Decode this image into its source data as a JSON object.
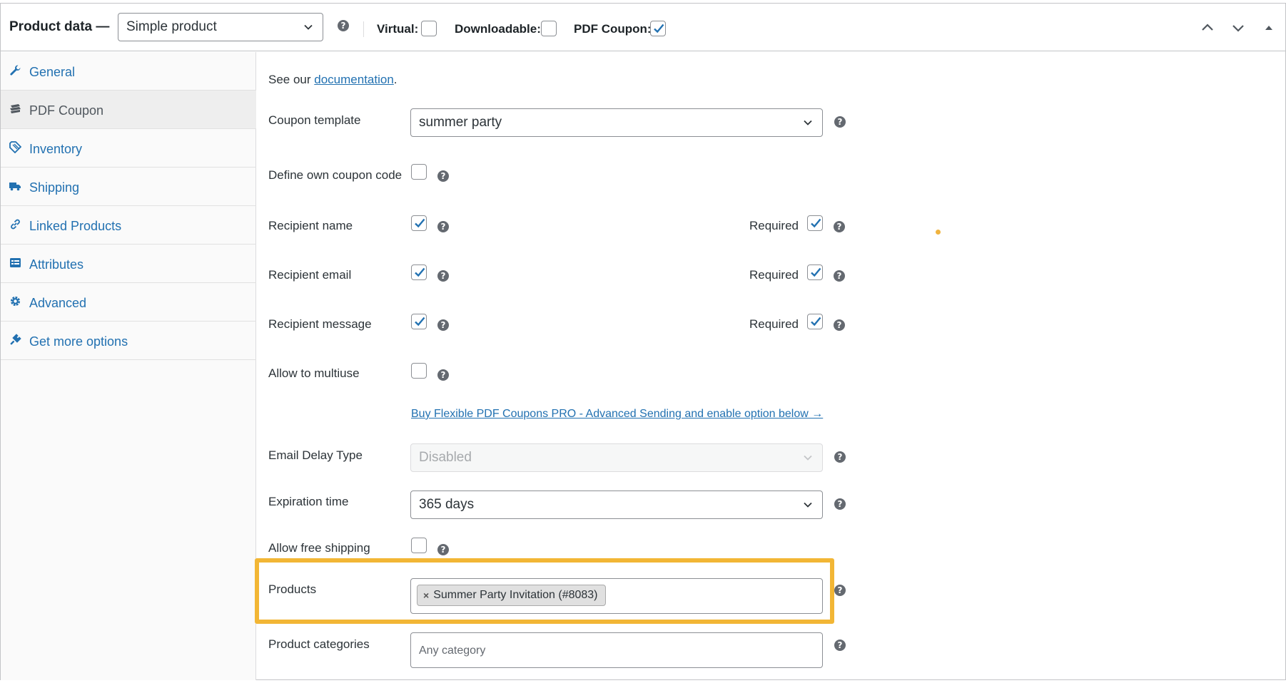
{
  "header": {
    "title": "Product data —",
    "product_type": "Simple product",
    "virtual_label": "Virtual:",
    "virtual_checked": false,
    "downloadable_label": "Downloadable:",
    "downloadable_checked": false,
    "pdf_coupon_label": "PDF Coupon:",
    "pdf_coupon_checked": true
  },
  "sidebar": {
    "items": [
      {
        "label": "General",
        "icon": "wrench-icon",
        "active": false
      },
      {
        "label": "PDF Coupon",
        "icon": "coupon-stack-icon",
        "active": true
      },
      {
        "label": "Inventory",
        "icon": "tag-icon",
        "active": false
      },
      {
        "label": "Shipping",
        "icon": "truck-icon",
        "active": false
      },
      {
        "label": "Linked Products",
        "icon": "link-icon",
        "active": false
      },
      {
        "label": "Attributes",
        "icon": "list-card-icon",
        "active": false
      },
      {
        "label": "Advanced",
        "icon": "gear-icon",
        "active": false
      },
      {
        "label": "Get more options",
        "icon": "plug-icon",
        "active": false
      }
    ]
  },
  "main": {
    "doc_prefix": "See our ",
    "doc_link": "documentation",
    "doc_suffix": ".",
    "coupon_template_label": "Coupon template",
    "coupon_template_value": "summer party",
    "define_code_label": "Define own coupon code",
    "recipient_name_label": "Recipient name",
    "recipient_email_label": "Recipient email",
    "recipient_message_label": "Recipient message",
    "required_label": "Required",
    "allow_multiuse_label": "Allow to multiuse",
    "pro_link": "Buy Flexible PDF Coupons PRO - Advanced Sending and enable option below →",
    "email_delay_label": "Email Delay Type",
    "email_delay_value": "Disabled",
    "expiration_label": "Expiration time",
    "expiration_value": "365 days",
    "free_shipping_label": "Allow free shipping",
    "products_label": "Products",
    "products_token": "Summer Party Invitation (#8083)",
    "categories_label": "Product categories",
    "categories_placeholder": "Any category"
  },
  "colors": {
    "link": "#2271b1",
    "highlight": "#f2b635",
    "checkbox_check": "#2271b1"
  }
}
